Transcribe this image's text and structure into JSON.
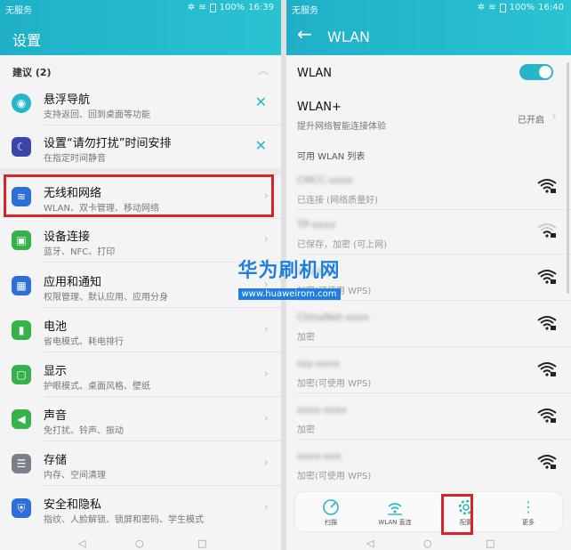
{
  "left": {
    "status": {
      "carrier": "无服务",
      "battery": "100%",
      "time": "16:39"
    },
    "title": "设置",
    "suggestions_label": "建议 (2)",
    "suggestions": [
      {
        "title": "悬浮导航",
        "subtitle": "支持返回、回到桌面等功能",
        "icon": "floating-nav-icon",
        "color": "#26b8c9"
      },
      {
        "title": "设置“请勿打扰”时间安排",
        "subtitle": "在指定时间静音",
        "icon": "moon-icon",
        "color": "#3b46a8"
      }
    ],
    "items": [
      {
        "title": "无线和网络",
        "subtitle": "WLAN、双卡管理、移动网络",
        "icon": "wifi-icon",
        "color": "#2d6fd8"
      },
      {
        "title": "设备连接",
        "subtitle": "蓝牙、NFC、打印",
        "icon": "device-connect-icon",
        "color": "#36b24a"
      },
      {
        "title": "应用和通知",
        "subtitle": "权限管理、默认应用、应用分身",
        "icon": "apps-icon",
        "color": "#2d6fd8"
      },
      {
        "title": "电池",
        "subtitle": "省电模式、耗电排行",
        "icon": "battery-icon",
        "color": "#36b24a"
      },
      {
        "title": "显示",
        "subtitle": "护眼模式、桌面风格、壁纸",
        "icon": "display-icon",
        "color": "#36b24a"
      },
      {
        "title": "声音",
        "subtitle": "免打扰、铃声、振动",
        "icon": "sound-icon",
        "color": "#36b24a"
      },
      {
        "title": "存储",
        "subtitle": "内存、空间清理",
        "icon": "storage-icon",
        "color": "#7a7f8a"
      },
      {
        "title": "安全和隐私",
        "subtitle": "指纹、人脸解锁、锁屏和密码、学生模式",
        "icon": "shield-icon",
        "color": "#2d6fd8"
      }
    ]
  },
  "right": {
    "status": {
      "carrier": "无服务",
      "battery": "100%",
      "time": "16:40"
    },
    "title": "WLAN",
    "wlan_label": "WLAN",
    "wlan_on": true,
    "wlanplus_label": "WLAN+",
    "wlanplus_sub": "提升网络智能连接体验",
    "wlanplus_value": "已开启",
    "list_title": "可用 WLAN 列表",
    "networks": [
      {
        "name": "CMCC-xxxx",
        "sub": "已连接 (网络质量好)",
        "strength": 4
      },
      {
        "name": "TP-xxxx",
        "sub": "已保存，加密 (可上网)",
        "strength": 2
      },
      {
        "name": "xxxxxx",
        "sub": "加密(可使用 WPS)",
        "strength": 4
      },
      {
        "name": "ChinaNet-xxxx",
        "sub": "加密",
        "strength": 4
      },
      {
        "name": "szy-xxxx",
        "sub": "加密(可使用 WPS)",
        "strength": 4
      },
      {
        "name": "xxxx-xxxx",
        "sub": "加密",
        "strength": 4
      },
      {
        "name": "xxxx-xxx",
        "sub": "加密(可使用 WPS)",
        "strength": 4
      }
    ],
    "bottom": [
      {
        "label": "扫描",
        "icon": "scan-icon"
      },
      {
        "label": "WLAN 直连",
        "icon": "wlan-direct-icon"
      },
      {
        "label": "配置",
        "icon": "settings-gear-icon"
      },
      {
        "label": "更多",
        "icon": "more-icon"
      }
    ]
  },
  "watermark": {
    "big": "华为刷机网",
    "small": "www.huaweirom.com"
  },
  "accent": "#27b6c8",
  "highlight_color": "#d8232a"
}
